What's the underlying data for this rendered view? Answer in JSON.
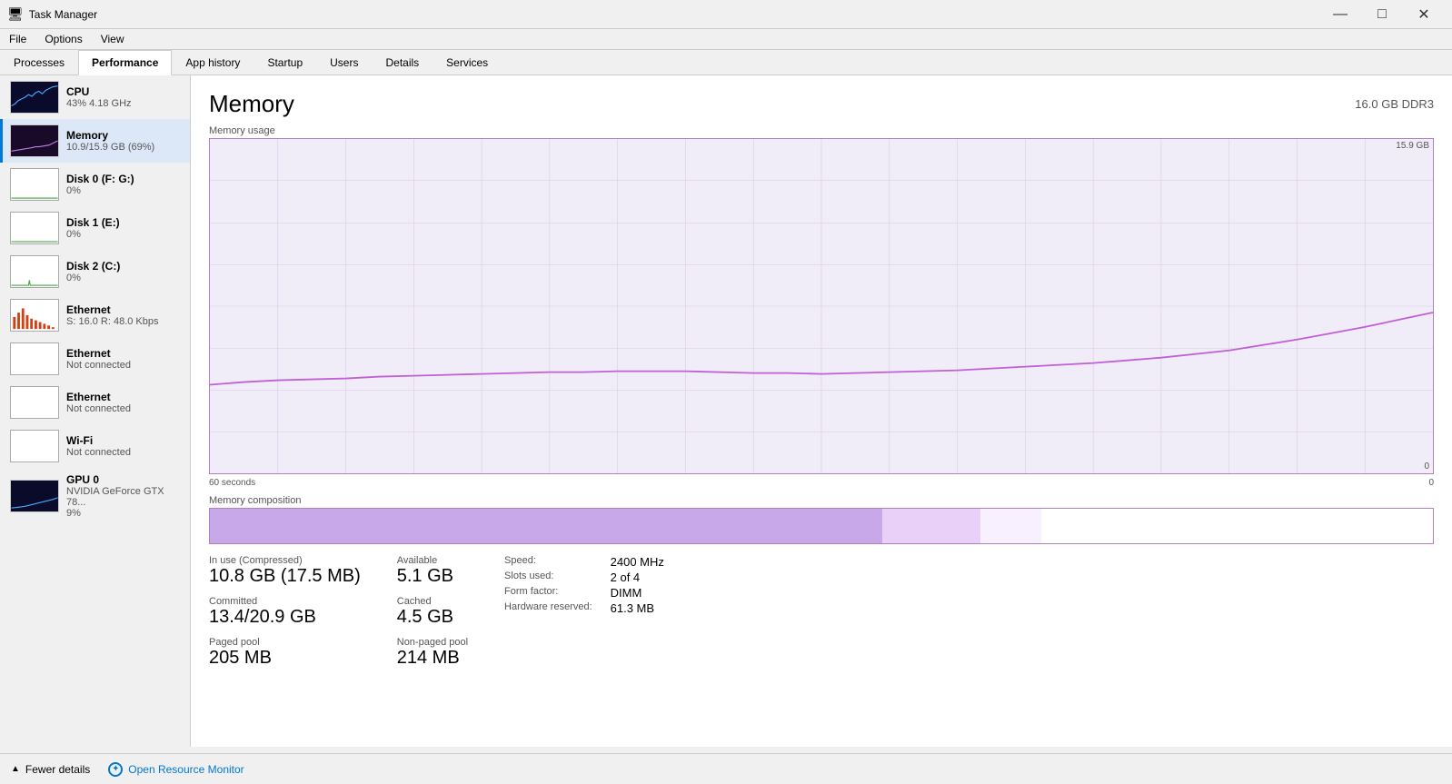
{
  "titleBar": {
    "icon": "🖥",
    "title": "Task Manager",
    "minimize": "—",
    "maximize": "□",
    "close": "✕"
  },
  "menuBar": {
    "items": [
      "File",
      "Options",
      "View"
    ]
  },
  "tabs": {
    "items": [
      "Processes",
      "Performance",
      "App history",
      "Startup",
      "Users",
      "Details",
      "Services"
    ],
    "active": "Performance"
  },
  "sidebar": {
    "items": [
      {
        "id": "cpu",
        "name": "CPU",
        "detail": "43% 4.18 GHz",
        "type": "cpu"
      },
      {
        "id": "memory",
        "name": "Memory",
        "detail": "10.9/15.9 GB (69%)",
        "type": "memory",
        "active": true
      },
      {
        "id": "disk0",
        "name": "Disk 0 (F: G:)",
        "detail": "0%",
        "type": "disk"
      },
      {
        "id": "disk1",
        "name": "Disk 1 (E:)",
        "detail": "0%",
        "type": "disk"
      },
      {
        "id": "disk2",
        "name": "Disk 2 (C:)",
        "detail": "0%",
        "type": "disk"
      },
      {
        "id": "ethernet0",
        "name": "Ethernet",
        "detail": "S: 16.0  R: 48.0 Kbps",
        "type": "ethernet-active"
      },
      {
        "id": "ethernet1",
        "name": "Ethernet",
        "detail": "Not connected",
        "type": "ethernet-idle"
      },
      {
        "id": "ethernet2",
        "name": "Ethernet",
        "detail": "Not connected",
        "type": "ethernet-idle"
      },
      {
        "id": "wifi",
        "name": "Wi-Fi",
        "detail": "Not connected",
        "type": "wifi"
      },
      {
        "id": "gpu0",
        "name": "GPU 0",
        "detail": "NVIDIA GeForce GTX 78...\n9%",
        "type": "gpu"
      }
    ]
  },
  "main": {
    "title": "Memory",
    "subtitle": "16.0 GB DDR3",
    "chart": {
      "label": "Memory usage",
      "yMax": "15.9 GB",
      "yMin": "0",
      "xLeft": "60 seconds",
      "xRight": "0"
    },
    "composition": {
      "label": "Memory composition"
    },
    "stats": {
      "inUse": {
        "label": "In use (Compressed)",
        "value": "10.8 GB (17.5 MB)"
      },
      "available": {
        "label": "Available",
        "value": "5.1 GB"
      },
      "committed": {
        "label": "Committed",
        "value": "13.4/20.9 GB"
      },
      "cached": {
        "label": "Cached",
        "value": "4.5 GB"
      },
      "pagedPool": {
        "label": "Paged pool",
        "value": "205 MB"
      },
      "nonPagedPool": {
        "label": "Non-paged pool",
        "value": "214 MB"
      }
    },
    "rightStats": {
      "speed": {
        "label": "Speed:",
        "value": "2400 MHz"
      },
      "slotsUsed": {
        "label": "Slots used:",
        "value": "2 of 4"
      },
      "formFactor": {
        "label": "Form factor:",
        "value": "DIMM"
      },
      "hardwareReserved": {
        "label": "Hardware reserved:",
        "value": "61.3 MB"
      }
    }
  },
  "bottomBar": {
    "fewerDetails": "Fewer details",
    "openResourceMonitor": "Open Resource Monitor"
  }
}
